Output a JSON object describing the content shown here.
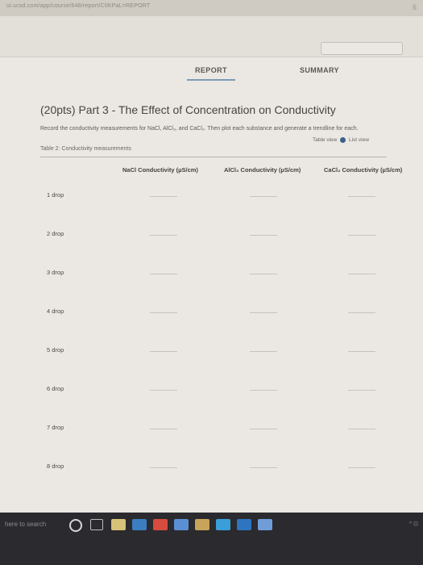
{
  "browser": {
    "url": "ui.ucsd.com/app/course/648/report/C0KPaL=REPORT",
    "top_right_icon": "6"
  },
  "tabs": [
    {
      "label": "REPORT",
      "active": true
    },
    {
      "label": "SUMMARY",
      "active": false
    }
  ],
  "section": {
    "title": "(20pts) Part 3 - The Effect of Concentration on Conductivity",
    "instructions": "Record the conductivity measurements for NaCl, AlCl₃, and CaCl₂. Then plot each substance and generate a trendline for each.",
    "table_caption": "Table 2: Conductivity measurements",
    "view_toggle": {
      "left": "Table view",
      "right": "List view"
    }
  },
  "table": {
    "columns": [
      "NaCl Conductivity (µS/cm)",
      "AlCl₃ Conductivity (µS/cm)",
      "CaCl₂ Conductivity (µS/cm)"
    ],
    "rows": [
      "1 drop",
      "2 drop",
      "3 drop",
      "4 drop",
      "5 drop",
      "6 drop",
      "7 drop",
      "8 drop"
    ]
  },
  "taskbar": {
    "search_placeholder": "here to search",
    "right_text": "^ ⊡"
  },
  "colors": {
    "accent": "#3b5f8a",
    "tab_underline": "#7d9ab5",
    "taskbar": "#2b2a2e"
  }
}
